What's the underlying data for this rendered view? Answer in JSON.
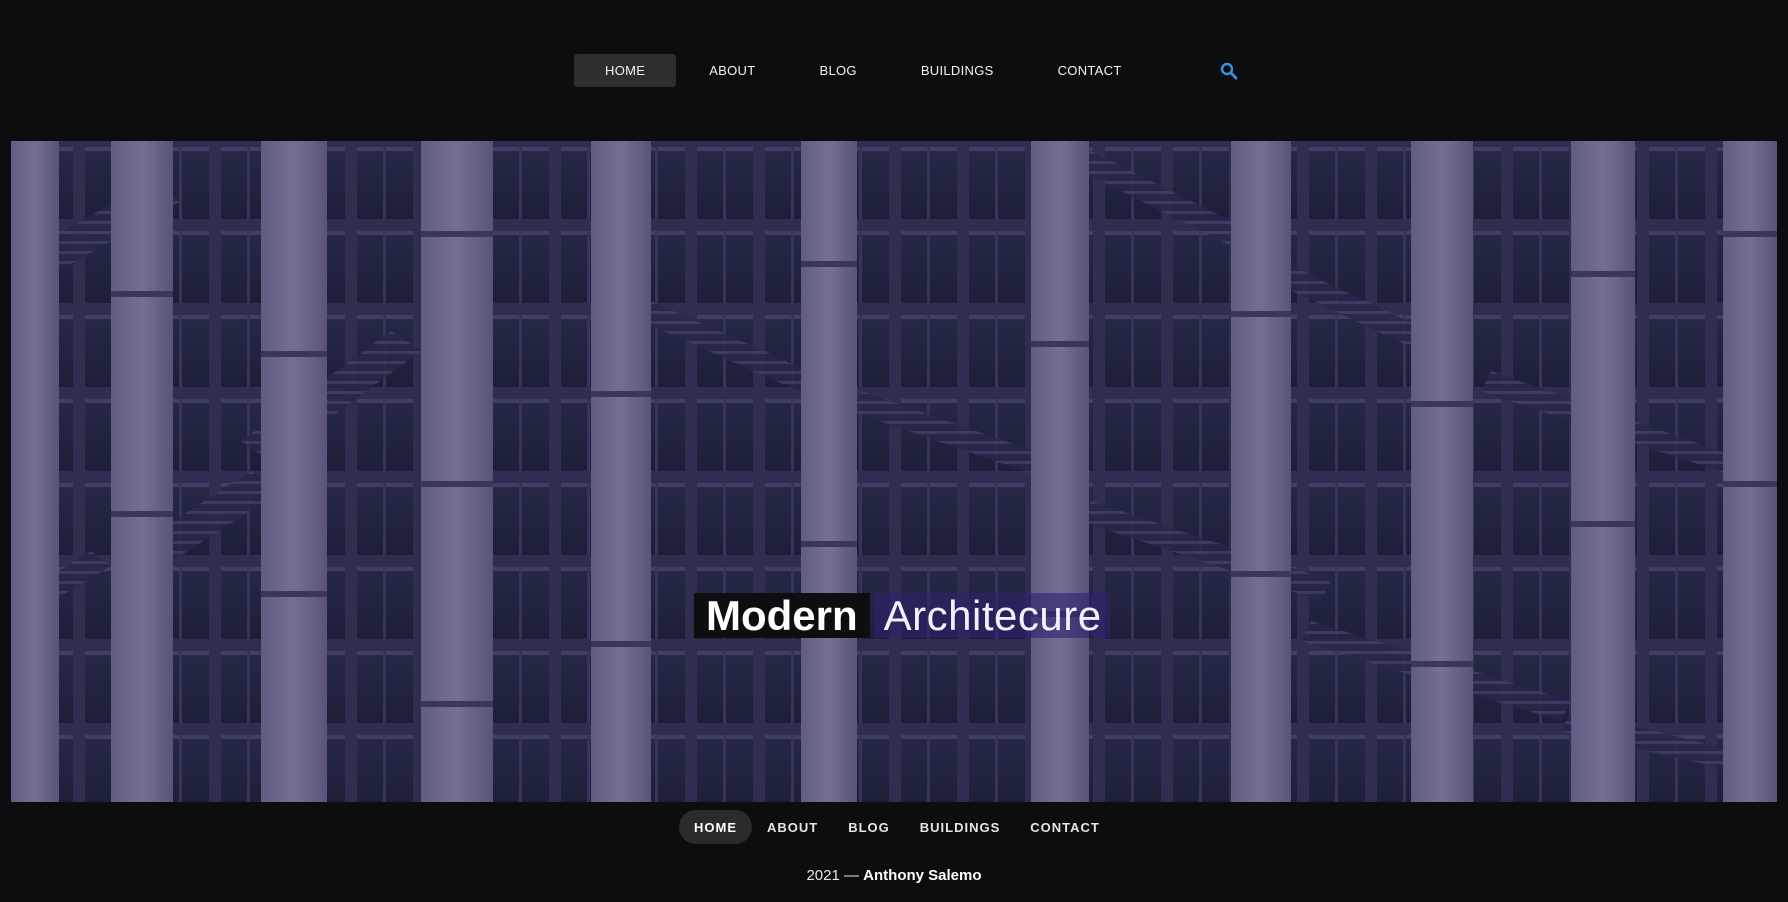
{
  "nav": {
    "items": [
      {
        "label": "HOME",
        "active": true
      },
      {
        "label": "ABOUT",
        "active": false
      },
      {
        "label": "BLOG",
        "active": false
      },
      {
        "label": "BUILDINGS",
        "active": false
      },
      {
        "label": "CONTACT",
        "active": false
      }
    ],
    "search_icon": "search-icon",
    "search_color": "#3b8fe0"
  },
  "hero": {
    "title_strong": "Modern",
    "title_light": "Architecure"
  },
  "footer": {
    "items": [
      {
        "label": "HOME",
        "active": true
      },
      {
        "label": "ABOUT",
        "active": false
      },
      {
        "label": "BLOG",
        "active": false
      },
      {
        "label": "BUILDINGS",
        "active": false
      },
      {
        "label": "CONTACT",
        "active": false
      }
    ],
    "year": "2021",
    "separator": "—",
    "author": "Anthony Salemo"
  },
  "colors": {
    "background": "#0c0d0f",
    "active_nav": "#2d2e30",
    "title_highlight": "#2e226e"
  }
}
